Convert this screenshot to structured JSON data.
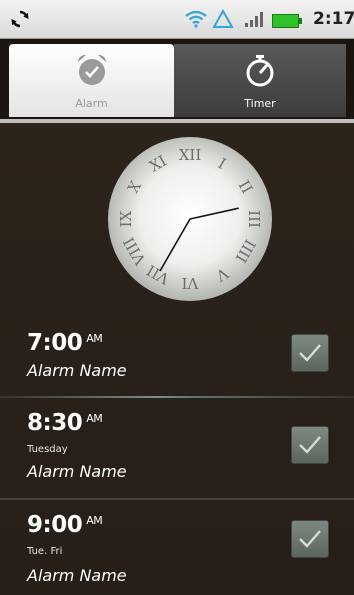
{
  "status_bar": {
    "time": "2:17",
    "icons": [
      "sync-icon",
      "wifi-icon",
      "triangle-icon",
      "signal-icon",
      "battery-icon"
    ],
    "battery_color": "#2ec12a",
    "accent": "#33a6dd"
  },
  "tabs": [
    {
      "label": "Alarm",
      "icon": "alarm-clock-icon",
      "selected": true
    },
    {
      "label": "Timer",
      "icon": "stopwatch-icon",
      "selected": false
    }
  ],
  "clock": {
    "numerals": [
      "XII",
      "I",
      "II",
      "III",
      "IIII",
      "V",
      "VI",
      "VII",
      "VIII",
      "IX",
      "X",
      "XI"
    ],
    "hour": 2,
    "minute": 35
  },
  "alarms": [
    {
      "time": "7:00",
      "ampm": "AM",
      "days": "",
      "name": "Alarm Name",
      "enabled": true
    },
    {
      "time": "8:30",
      "ampm": "AM",
      "days": "Tuesday",
      "name": "Alarm Name",
      "enabled": true
    },
    {
      "time": "9:00",
      "ampm": "AM",
      "days": "Tue. Fri",
      "name": "Alarm Name",
      "enabled": true
    }
  ]
}
